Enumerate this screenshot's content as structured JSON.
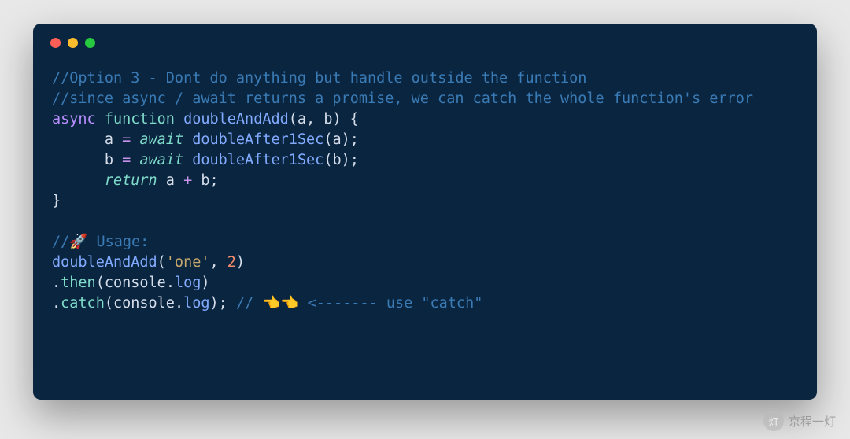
{
  "window": {
    "buttons": [
      "close",
      "minimize",
      "zoom"
    ]
  },
  "code": {
    "c1": "//Option 3 - Dont do anything but handle outside the function",
    "c2": "//since async / await returns a promise, we can catch the whole function's error",
    "l3": {
      "async": "async",
      "function": "function",
      "name": "doubleAndAdd",
      "open": "(",
      "a": "a",
      "comma1": ", ",
      "b": "b",
      "close": ") {"
    },
    "l4": {
      "indent": "      ",
      "lhs": "a",
      "eq": " = ",
      "await": "await",
      "sp": " ",
      "fn": "doubleAfter1Sec",
      "open": "(",
      "arg": "a",
      "close": ");"
    },
    "l5": {
      "indent": "      ",
      "lhs": "b",
      "eq": " = ",
      "await": "await",
      "sp": " ",
      "fn": "doubleAfter1Sec",
      "open": "(",
      "arg": "b",
      "close": ");"
    },
    "l6": {
      "indent": "      ",
      "return": "return",
      "sp": " ",
      "a": "a",
      "plus": " + ",
      "b": "b",
      "semi": ";"
    },
    "l7": "}",
    "l8": "",
    "l9": {
      "slashes": "//",
      "rocket": "🚀",
      "text": " Usage:"
    },
    "l10": {
      "fn": "doubleAndAdd",
      "open": "(",
      "str": "'one'",
      "comma": ", ",
      "num": "2",
      "close": ")"
    },
    "l11": {
      "dot": ".",
      "then": "then",
      "open": "(",
      "cons": "console",
      "dot2": ".",
      "log": "log",
      "close": ")"
    },
    "l12": {
      "dot": ".",
      "catch": "catch",
      "open": "(",
      "cons": "console",
      "dot2": ".",
      "log": "log",
      "close": "); ",
      "cm1": "// ",
      "hand1": "👈",
      "hand2": "👈",
      "cm2": " <------- use \"catch\""
    }
  },
  "badge": {
    "text": "京程一灯"
  }
}
